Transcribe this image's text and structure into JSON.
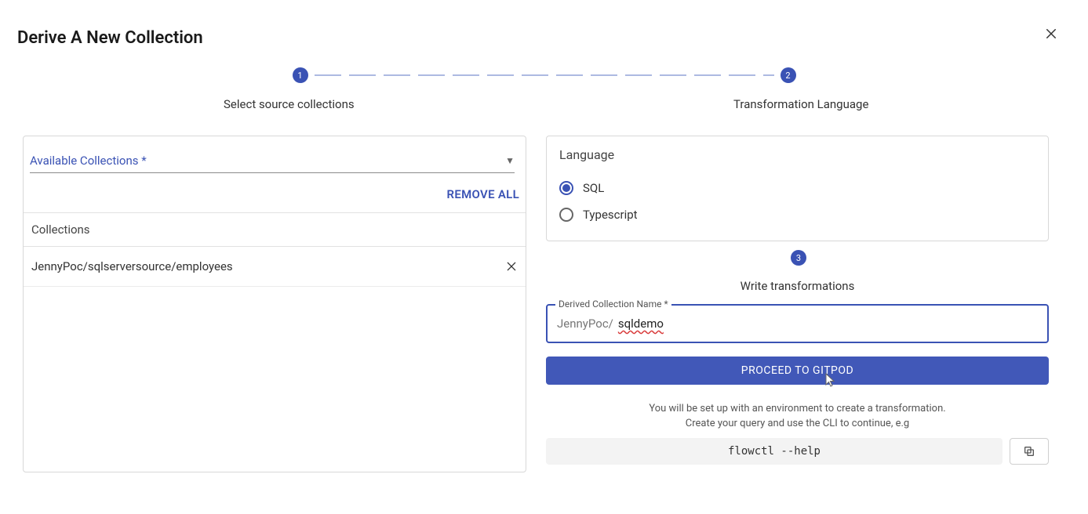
{
  "title": "Derive A New Collection",
  "steps": {
    "s1": {
      "num": "1",
      "label": "Select source collections"
    },
    "s2": {
      "num": "2",
      "label": "Transformation Language"
    },
    "s3": {
      "num": "3",
      "label": "Write transformations"
    }
  },
  "leftPanel": {
    "availableLabel": "Available Collections *",
    "removeAll": "REMOVE ALL",
    "collectionsHeader": "Collections",
    "items": [
      {
        "name": "JennyPoc/sqlserversource/employees"
      }
    ]
  },
  "language": {
    "title": "Language",
    "options": {
      "sql": "SQL",
      "typescript": "Typescript"
    },
    "selected": "sql"
  },
  "derived": {
    "legend": "Derived Collection Name *",
    "prefix": "JennyPoc/",
    "value": "sqldemo"
  },
  "proceedLabel": "PROCEED TO GITPOD",
  "helper": {
    "line1": "You will be set up with an environment to create a transformation.",
    "line2": "Create your query and use the CLI to continue, e.g"
  },
  "cliCommand": "flowctl --help"
}
